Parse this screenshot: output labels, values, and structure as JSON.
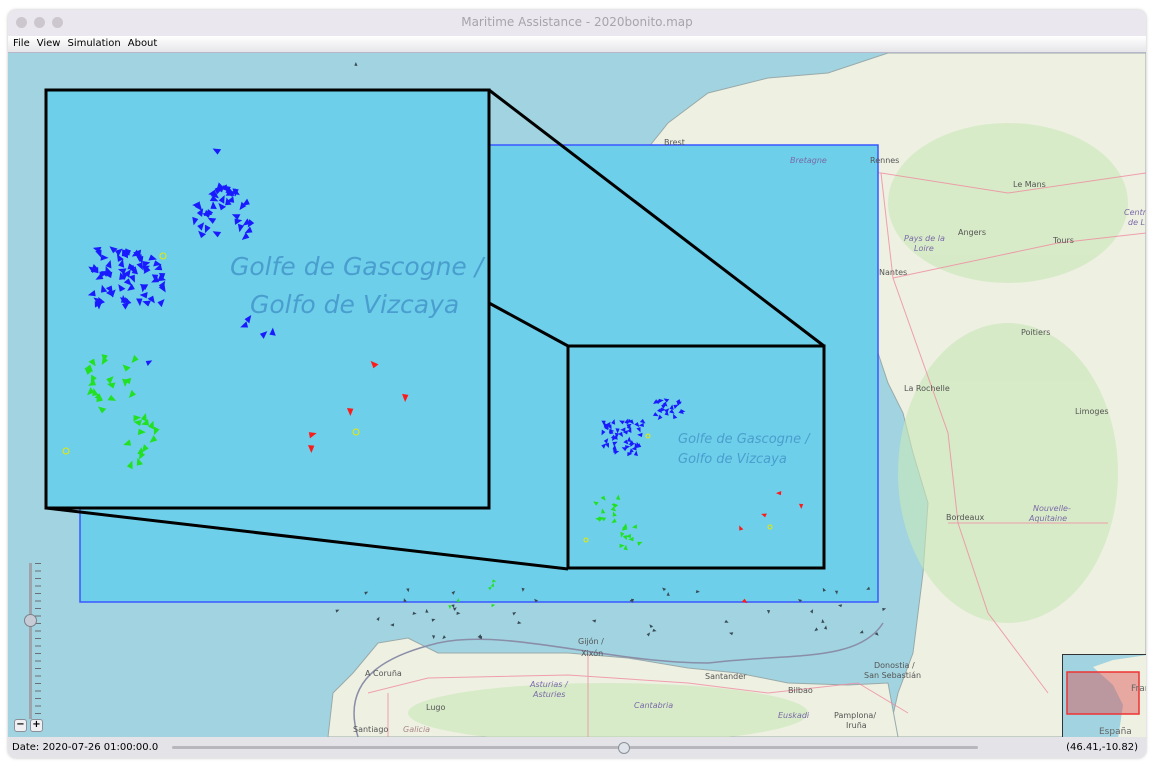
{
  "window": {
    "title": "Maritime Assistance - 2020bonito.map"
  },
  "menu": [
    "File",
    "View",
    "Simulation",
    "About"
  ],
  "map": {
    "sea_label_line1": "Golfe de Gascogne /",
    "sea_label_line2": "Golfo de Vizcaya",
    "places": {
      "brest": "Brest",
      "rennes": "Rennes",
      "bretagne": "Bretagne",
      "le_mans": "Le Mans",
      "angers": "Angers",
      "tours": "Tours",
      "pays_loire1": "Pays de la",
      "pays_loire2": "Loire",
      "nantes": "Nantes",
      "poitiers": "Poitiers",
      "la_rochelle": "La Rochelle",
      "limoges": "Limoges",
      "bordeaux": "Bordeaux",
      "nouvelle1": "Nouvelle-",
      "nouvelle2": "Aquitaine",
      "centre1": "Centr",
      "centre2": "de L",
      "donostia1": "Donostia /",
      "donostia2": "San Sebastián",
      "bilbao": "Bilbao",
      "santander": "Santander",
      "gijon1": "Gijón /",
      "gijon2": "Xixón",
      "coruna": "A Coruña",
      "lugo": "Lugo",
      "asturias1": "Asturias /",
      "asturias2": "Asturies",
      "cantabria": "Cantabria",
      "euskadi": "Euskadi",
      "pamplona1": "Pamplona/",
      "pamplona2": "Iruña",
      "santiago": "Santiago",
      "galicia": "Galicia"
    },
    "overview": {
      "france": "Fran",
      "espana": "España"
    },
    "colors": {
      "selection": "#6dcfe9",
      "fleet_a": "#1a1aff",
      "fleet_b": "#22e022",
      "fleet_c": "#ff1a1a",
      "marker": "#e8e800"
    }
  },
  "zoom_controls": {
    "minus": "−",
    "plus": "+"
  },
  "status": {
    "date": "Date: 2020-07-26 01:00:00.0",
    "coords": "(46.41,-10.82)",
    "timeline_fraction": 0.56
  }
}
